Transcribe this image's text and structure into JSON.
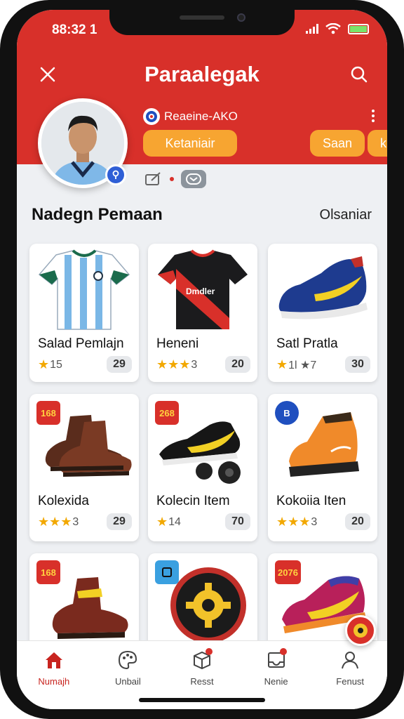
{
  "status_bar": {
    "time": "88:32 1"
  },
  "header": {
    "title": "Paraalegak"
  },
  "profile": {
    "username": "Reaeine-AKO",
    "primary_button": "Ketaniair",
    "secondary_button": "Saan",
    "cut_button": "k"
  },
  "section": {
    "title": "Nadegn Pemaan",
    "link": "Olsaniar"
  },
  "products": [
    {
      "name": "Salad Pemlajn",
      "rating": "15",
      "count": "29",
      "stars": 1,
      "tag": ""
    },
    {
      "name": "Heneni",
      "rating": "3",
      "count": "20",
      "stars": 3,
      "tag": ""
    },
    {
      "name": "Satl Pratla",
      "rating": "1l ★7",
      "count": "30",
      "stars": 1,
      "tag": ""
    },
    {
      "name": "Kolexida",
      "rating": "3",
      "count": "29",
      "stars": 3,
      "tag": "168"
    },
    {
      "name": "Kolecin Item",
      "rating": "14",
      "count": "70",
      "stars": 1,
      "tag": "268"
    },
    {
      "name": "Kokoiia Iten",
      "rating": "3",
      "count": "20",
      "stars": 3,
      "tag": "B"
    },
    {
      "name": "",
      "rating": "",
      "count": "",
      "stars": 0,
      "tag": "168"
    },
    {
      "name": "",
      "rating": "",
      "count": "",
      "stars": 0,
      "tag": ""
    },
    {
      "name": "",
      "rating": "",
      "count": "",
      "stars": 0,
      "tag": "2076"
    }
  ],
  "tabs": [
    {
      "label": "Numajh",
      "icon": "home-icon"
    },
    {
      "label": "Unbail",
      "icon": "palette-icon"
    },
    {
      "label": "Resst",
      "icon": "box-icon"
    },
    {
      "label": "Nenie",
      "icon": "inbox-icon"
    },
    {
      "label": "Fenust",
      "icon": "user-icon"
    }
  ],
  "colors": {
    "brand_red": "#d8302a",
    "accent_orange": "#f7a531",
    "star": "#f2a800"
  }
}
